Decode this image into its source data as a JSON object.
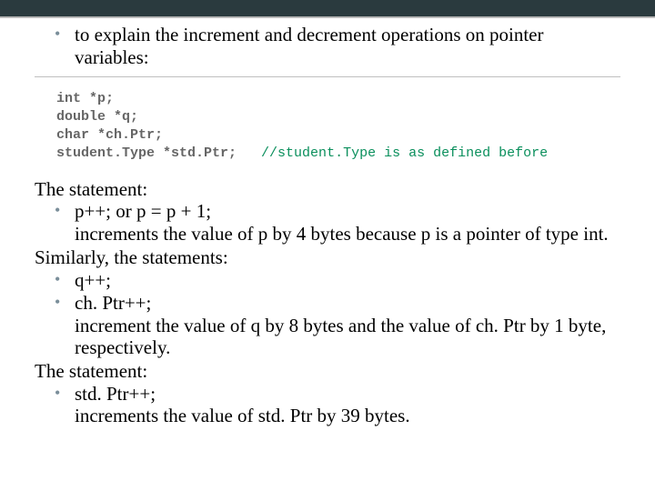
{
  "intro": {
    "bullet": "to explain the increment and decrement operations on pointer variables:"
  },
  "code": {
    "l1": "int *p;",
    "l2": "double *q;",
    "l3": "char *ch.Ptr;",
    "l4": "student.Type *std.Ptr;",
    "l4_comment": "   //student.Type is as defined before"
  },
  "s1": {
    "title": "The statement:",
    "b1": "p++; or p = p + 1;",
    "explain": "increments the value of p by 4 bytes because p is a pointer of type int."
  },
  "s2": {
    "title": "Similarly, the statements:",
    "b1": "q++;",
    "b2": "ch. Ptr++;",
    "explain": "increment the value of q by 8 bytes and the value of ch. Ptr by 1 byte, respectively."
  },
  "s3": {
    "title": "The statement:",
    "b1": "std. Ptr++;",
    "explain": "increments the value of std. Ptr by 39 bytes."
  }
}
